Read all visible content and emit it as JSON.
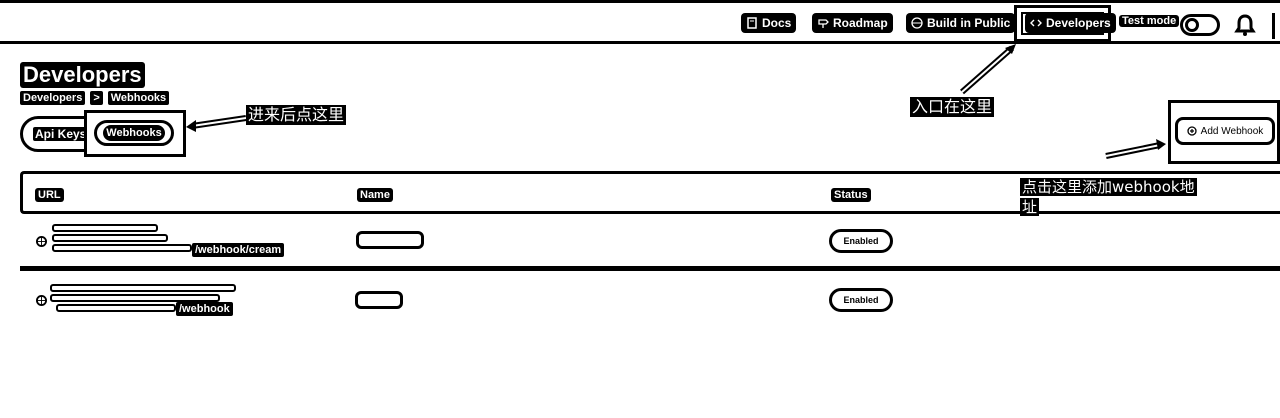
{
  "header": {
    "docs": "Docs",
    "roadmap": "Roadmap",
    "build_in_public": "Build in Public",
    "developers": "Developers",
    "test_mode": "Test mode"
  },
  "page": {
    "title": "Developers",
    "breadcrumb": [
      "Developers",
      ">",
      "Webhooks"
    ]
  },
  "tabs": [
    "Api Keys",
    "Webhooks"
  ],
  "add_webhook": "Add Webhook",
  "annotations": {
    "tabs_hint": "进来后点这里",
    "entry_hint": "入口在这里",
    "add_hint_line1": "点击这里添加webhook地",
    "add_hint_line2": "址"
  },
  "table": {
    "columns": [
      "URL",
      "Name",
      "Status"
    ],
    "rows": [
      {
        "url_visible": "/webhook/cream",
        "status": "Enabled"
      },
      {
        "url_visible": "/webhook",
        "status": "Enabled"
      }
    ]
  }
}
